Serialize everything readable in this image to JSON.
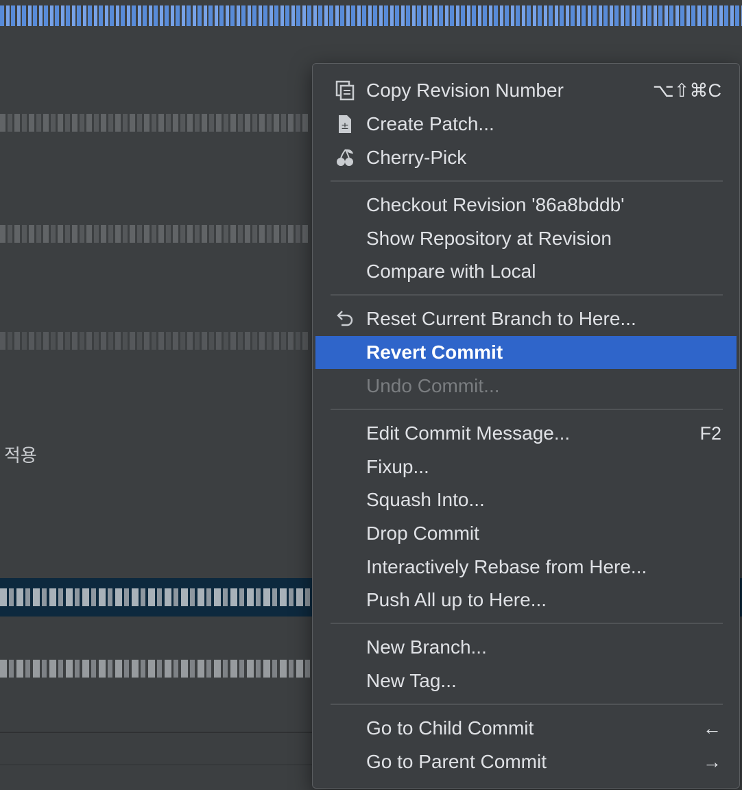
{
  "background": {
    "korean_text": "적용"
  },
  "context_menu": {
    "groups": [
      [
        {
          "label": "Copy Revision Number",
          "shortcut": "⌥⇧⌘C",
          "icon": "copy-icon"
        },
        {
          "label": "Create Patch...",
          "shortcut": "",
          "icon": "patch-icon"
        },
        {
          "label": "Cherry-Pick",
          "shortcut": "",
          "icon": "cherry-icon"
        }
      ],
      [
        {
          "label": "Checkout Revision '86a8bddb'",
          "shortcut": ""
        },
        {
          "label": "Show Repository at Revision",
          "shortcut": ""
        },
        {
          "label": "Compare with Local",
          "shortcut": ""
        }
      ],
      [
        {
          "label": "Reset Current Branch to Here...",
          "shortcut": "",
          "icon": "reset-icon"
        },
        {
          "label": "Revert Commit",
          "shortcut": "",
          "state": "highlighted"
        },
        {
          "label": "Undo Commit...",
          "shortcut": "",
          "state": "disabled"
        }
      ],
      [
        {
          "label": "Edit Commit Message...",
          "shortcut": "F2"
        },
        {
          "label": "Fixup...",
          "shortcut": ""
        },
        {
          "label": "Squash Into...",
          "shortcut": ""
        },
        {
          "label": "Drop Commit",
          "shortcut": ""
        },
        {
          "label": "Interactively Rebase from Here...",
          "shortcut": ""
        },
        {
          "label": "Push All up to Here...",
          "shortcut": ""
        }
      ],
      [
        {
          "label": "New Branch...",
          "shortcut": ""
        },
        {
          "label": "New Tag...",
          "shortcut": ""
        }
      ],
      [
        {
          "label": "Go to Child Commit",
          "shortcut": "←"
        },
        {
          "label": "Go to Parent Commit",
          "shortcut": "→"
        }
      ]
    ]
  },
  "colors": {
    "menu_background": "#3b3e41",
    "highlight": "#2f65ca",
    "selected_row": "#0d293e",
    "disabled_text": "#7a7d80"
  }
}
